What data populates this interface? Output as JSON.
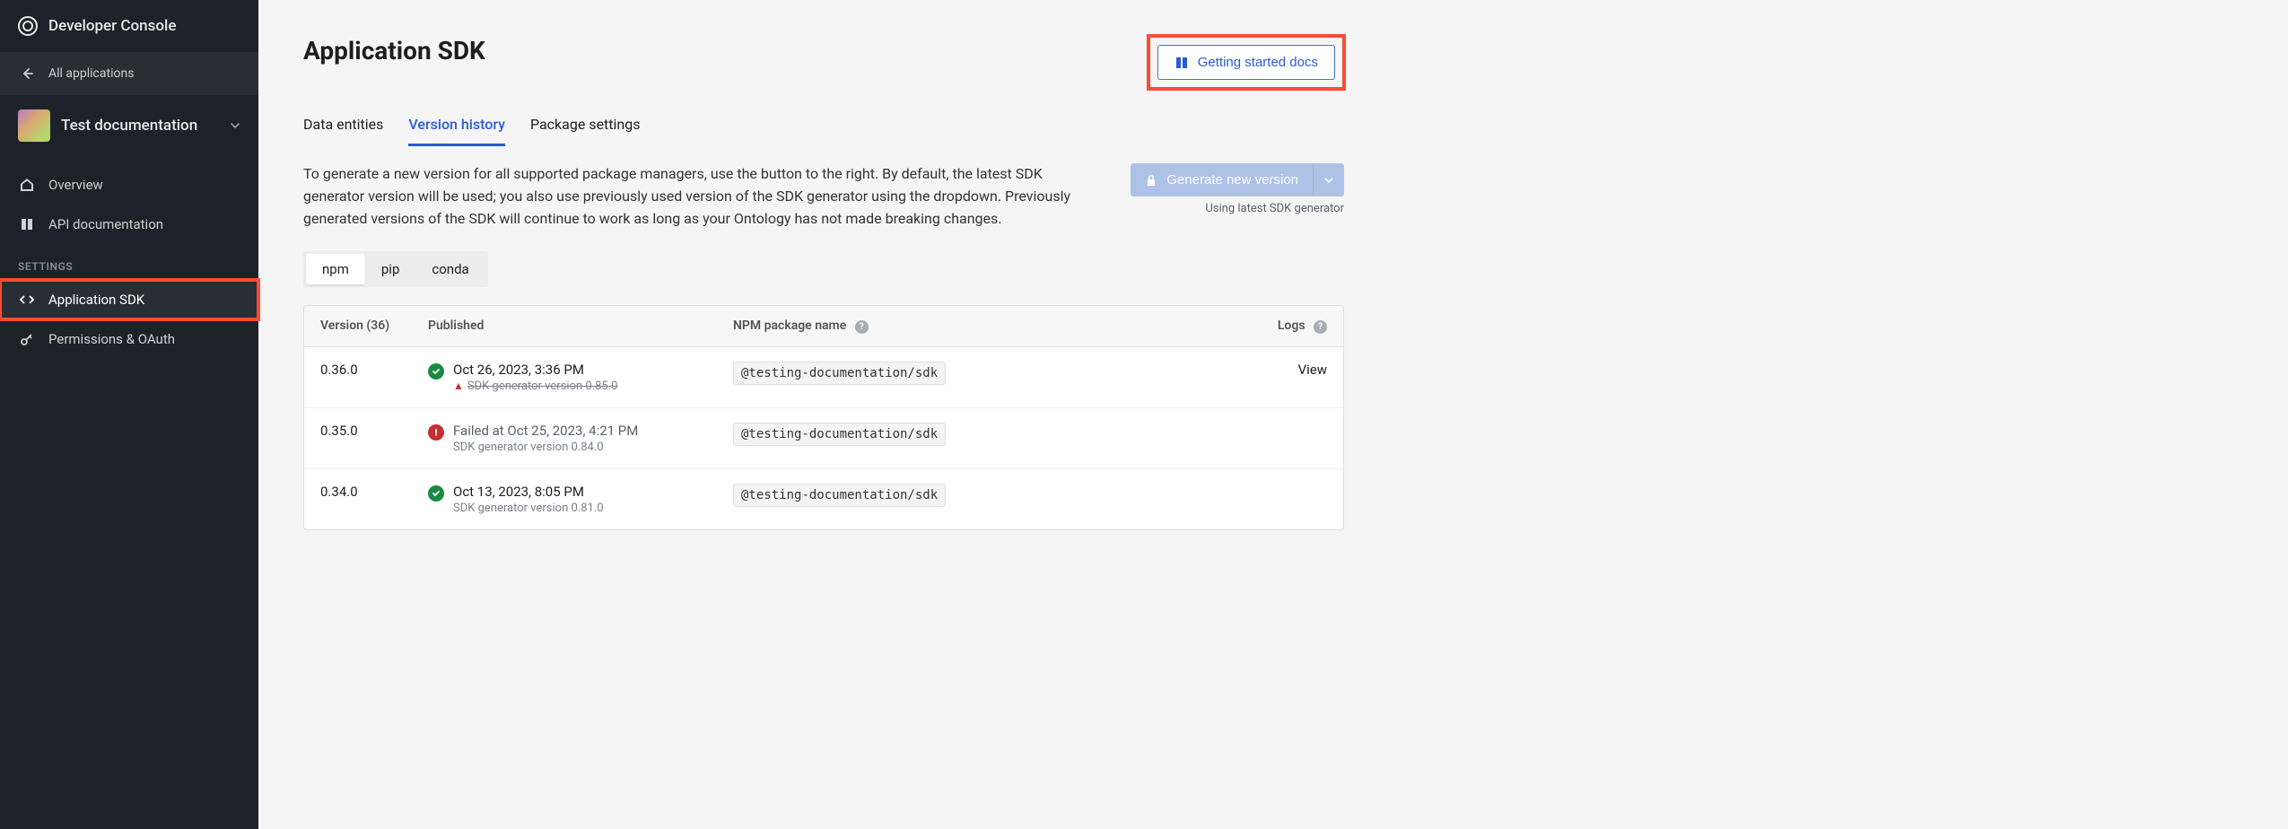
{
  "sidebar": {
    "title": "Developer Console",
    "back_label": "All applications",
    "app_name": "Test documentation",
    "nav": {
      "overview": "Overview",
      "api_doc": "API documentation"
    },
    "settings_label": "SETTINGS",
    "settings": {
      "app_sdk": "Application SDK",
      "perm_oauth": "Permissions & OAuth"
    }
  },
  "page": {
    "title": "Application SDK",
    "docs_button": "Getting started docs",
    "tabs": {
      "data_entities": "Data entities",
      "version_history": "Version history",
      "package_settings": "Package settings"
    },
    "description": "To generate a new version for all supported package managers, use the button to the right. By default, the latest SDK generator version will be used; you also use previously used version of the SDK generator using the dropdown. Previously generated versions of the SDK will continue to work as long as your Ontology has not made breaking changes.",
    "generate_button": "Generate new version",
    "generate_sub": "Using latest SDK generator",
    "pm_tabs": {
      "npm": "npm",
      "pip": "pip",
      "conda": "conda"
    },
    "table": {
      "col_version": "Version (36)",
      "col_published": "Published",
      "col_package": "NPM package name",
      "col_logs": "Logs"
    },
    "versions": [
      {
        "version": "0.36.0",
        "status": "ok",
        "published": "Oct 26, 2023, 3:36 PM",
        "sub": "SDK generator version 0.85.0",
        "sub_deprecated": true,
        "package": "@testing-documentation/sdk",
        "logs": "View"
      },
      {
        "version": "0.35.0",
        "status": "error",
        "published": "Failed at Oct 25, 2023, 4:21 PM",
        "sub": "SDK generator version 0.84.0",
        "sub_deprecated": false,
        "package": "@testing-documentation/sdk",
        "logs": ""
      },
      {
        "version": "0.34.0",
        "status": "ok",
        "published": "Oct 13, 2023, 8:05 PM",
        "sub": "SDK generator version 0.81.0",
        "sub_deprecated": false,
        "package": "@testing-documentation/sdk",
        "logs": ""
      }
    ]
  }
}
